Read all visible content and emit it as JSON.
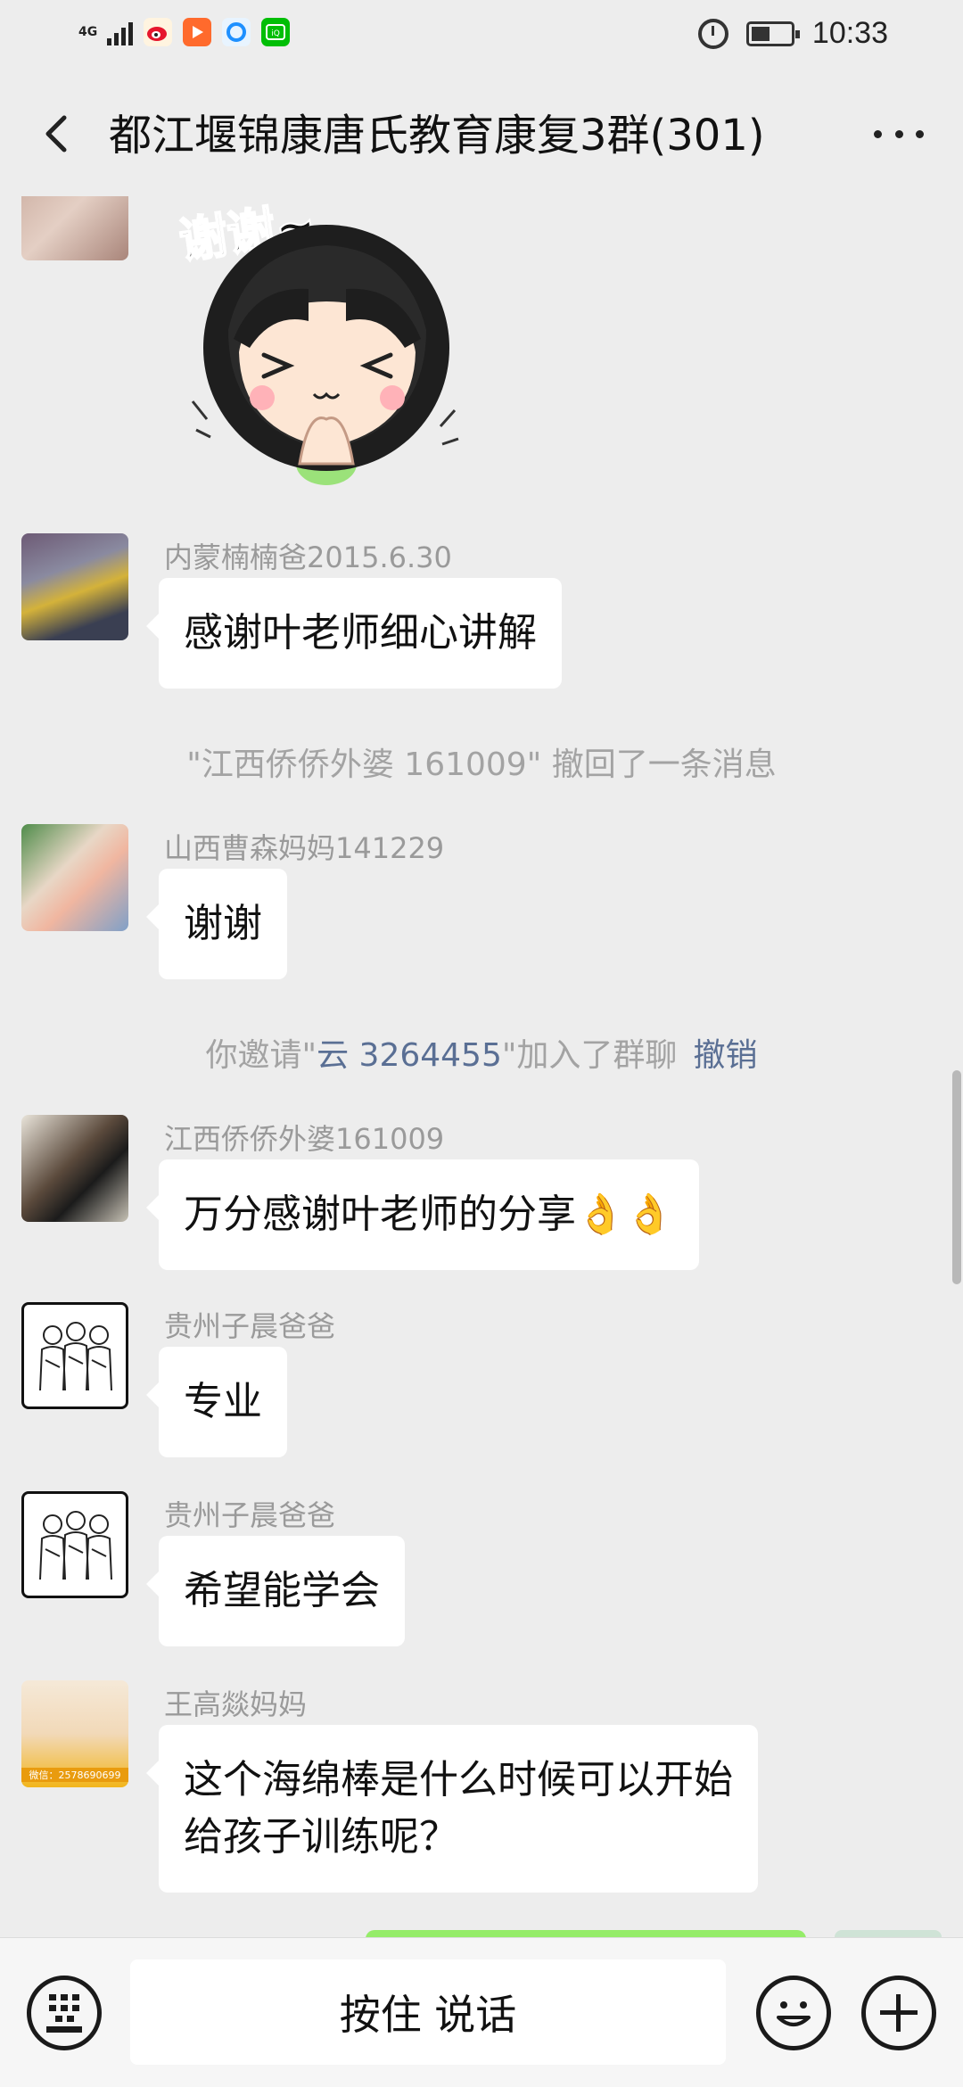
{
  "status_bar": {
    "network": "4G",
    "time": "10:33",
    "apps": [
      "weibo-icon",
      "video-app-icon",
      "browser-icon",
      "iqiyi-icon"
    ]
  },
  "header": {
    "title": "都江堰锦康唐氏教育康复3群(301)",
    "back_icon": "chevron-left-icon",
    "more_icon": "more-dots-icon"
  },
  "sticker": {
    "text": "谢谢~"
  },
  "messages": [
    {
      "sender": "内蒙楠楠爸2015.6.30",
      "text": "感谢叶老师细心讲解"
    },
    {
      "sender": "山西曹森妈妈141229",
      "text": "谢谢"
    },
    {
      "sender": "江西侨侨外婆161009",
      "text": "万分感谢叶老师的分享👌👌"
    },
    {
      "sender": "贵州子晨爸爸",
      "text": "专业"
    },
    {
      "sender": "贵州子晨爸爸",
      "text": "希望能学会"
    },
    {
      "sender": "王高燚妈妈",
      "line1": "这个海绵棒是什么时候可以开始",
      "line2": "给孩子训练呢？",
      "avatar_caption": "微信：2578690699"
    }
  ],
  "system": {
    "recall": "\"江西侨侨外婆 161009\" 撤回了一条消息",
    "invite_prefix": "你邀请\"",
    "invite_name": "云 3264455",
    "invite_suffix": "\"加入了群聊",
    "invite_undo": "撤销"
  },
  "input_bar": {
    "talk_label": "按住 说话",
    "keyboard_icon": "keyboard-icon",
    "emoji_icon": "emoji-icon",
    "plus_icon": "plus-icon"
  },
  "colors": {
    "background": "#ededed",
    "bubble": "#ffffff",
    "system_link": "#5a6f94",
    "sender_name": "#9a9a9a"
  }
}
